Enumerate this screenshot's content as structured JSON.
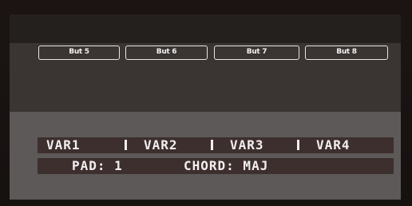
{
  "soft_buttons": [
    {
      "label": "But 5"
    },
    {
      "label": "But 6"
    },
    {
      "label": "But 7"
    },
    {
      "label": "But 8"
    }
  ],
  "var_row": {
    "items": [
      "VAR1",
      "VAR2",
      "VAR3",
      "VAR4"
    ]
  },
  "pad_row": {
    "pad_text": "PAD: 1",
    "chord_text": "CHORD: MAJ"
  },
  "colors": {
    "lcd_background": "#5c5958",
    "text": "#f3eff0",
    "row_bar": "#3c2f2e"
  }
}
